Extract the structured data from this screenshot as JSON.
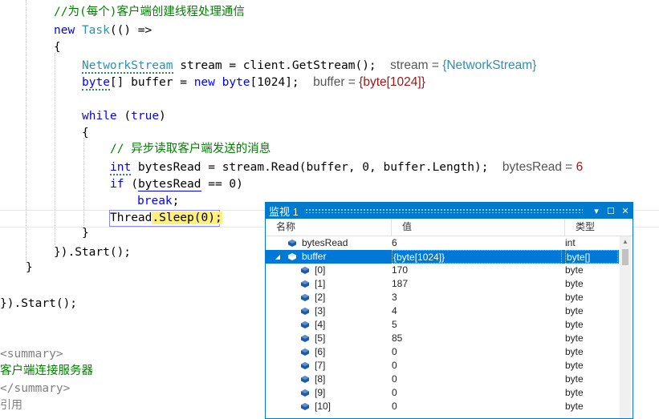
{
  "code": {
    "comment_thread": "//为(每个)客户端创建线程处理通信",
    "kw_new": "new",
    "ty_task": "Task",
    "task_open": "(() =>",
    "brace_open": "{",
    "brace_close": "}",
    "ty_networkstream": "NetworkStream",
    "stream_decl": " stream = client.GetStream();",
    "stream_hint_name": "stream = ",
    "stream_hint_value": "{NetworkStream}",
    "kw_byte": "byte",
    "buffer_decl_a": "[] buffer = ",
    "buffer_decl_b": " byte",
    "buffer_decl_c": "[1024];",
    "buffer_hint_name": "buffer = ",
    "buffer_hint_value": "{byte[1024]}",
    "kw_while": "while",
    "while_open": " (",
    "kw_true": "true",
    "while_close": ")",
    "comment_read": "// 异步读取客户端发送的消息",
    "kw_int": "int",
    "read_decl": " bytesRead = stream.Read(buffer, 0, buffer.Length);",
    "read_hint_name": "bytesRead = ",
    "read_hint_value": "6",
    "kw_if": "if",
    "if_a": " (",
    "if_var": "bytesRead",
    "if_b": " == 0)",
    "kw_break": "break",
    "semi": ";",
    "sleep_a": "Thread",
    "sleep_b": ".Sleep(0);",
    "start_inner": "}).Start();",
    "start_outer": "}).Start();",
    "summary_open": "<summary>",
    "summary_text": "客户端连接服务器",
    "summary_close": "</summary>",
    "references": "引用"
  },
  "watch": {
    "title": "监视 1",
    "pin": "▾",
    "maximize": "☐",
    "close": "✕",
    "columns": [
      "名称",
      "值",
      "类型"
    ],
    "rows": [
      {
        "name": "bytesRead",
        "value": "6",
        "type": "int",
        "expander": "",
        "indent": 0,
        "selected": false
      },
      {
        "name": "buffer",
        "value": "{byte[1024]}",
        "type": "byte[]",
        "expander": "◢",
        "indent": 0,
        "selected": true
      },
      {
        "name": "[0]",
        "value": "170",
        "type": "byte",
        "expander": "",
        "indent": 1,
        "selected": false
      },
      {
        "name": "[1]",
        "value": "187",
        "type": "byte",
        "expander": "",
        "indent": 1,
        "selected": false
      },
      {
        "name": "[2]",
        "value": "3",
        "type": "byte",
        "expander": "",
        "indent": 1,
        "selected": false
      },
      {
        "name": "[3]",
        "value": "4",
        "type": "byte",
        "expander": "",
        "indent": 1,
        "selected": false
      },
      {
        "name": "[4]",
        "value": "5",
        "type": "byte",
        "expander": "",
        "indent": 1,
        "selected": false
      },
      {
        "name": "[5]",
        "value": "85",
        "type": "byte",
        "expander": "",
        "indent": 1,
        "selected": false
      },
      {
        "name": "[6]",
        "value": "0",
        "type": "byte",
        "expander": "",
        "indent": 1,
        "selected": false
      },
      {
        "name": "[7]",
        "value": "0",
        "type": "byte",
        "expander": "",
        "indent": 1,
        "selected": false
      },
      {
        "name": "[8]",
        "value": "0",
        "type": "byte",
        "expander": "",
        "indent": 1,
        "selected": false
      },
      {
        "name": "[9]",
        "value": "0",
        "type": "byte",
        "expander": "",
        "indent": 1,
        "selected": false
      },
      {
        "name": "[10]",
        "value": "0",
        "type": "byte",
        "expander": "",
        "indent": 1,
        "selected": false
      }
    ],
    "scroll_up": "▲",
    "cube_color": "#1e5aa8",
    "selected_color": "#0078d7"
  }
}
